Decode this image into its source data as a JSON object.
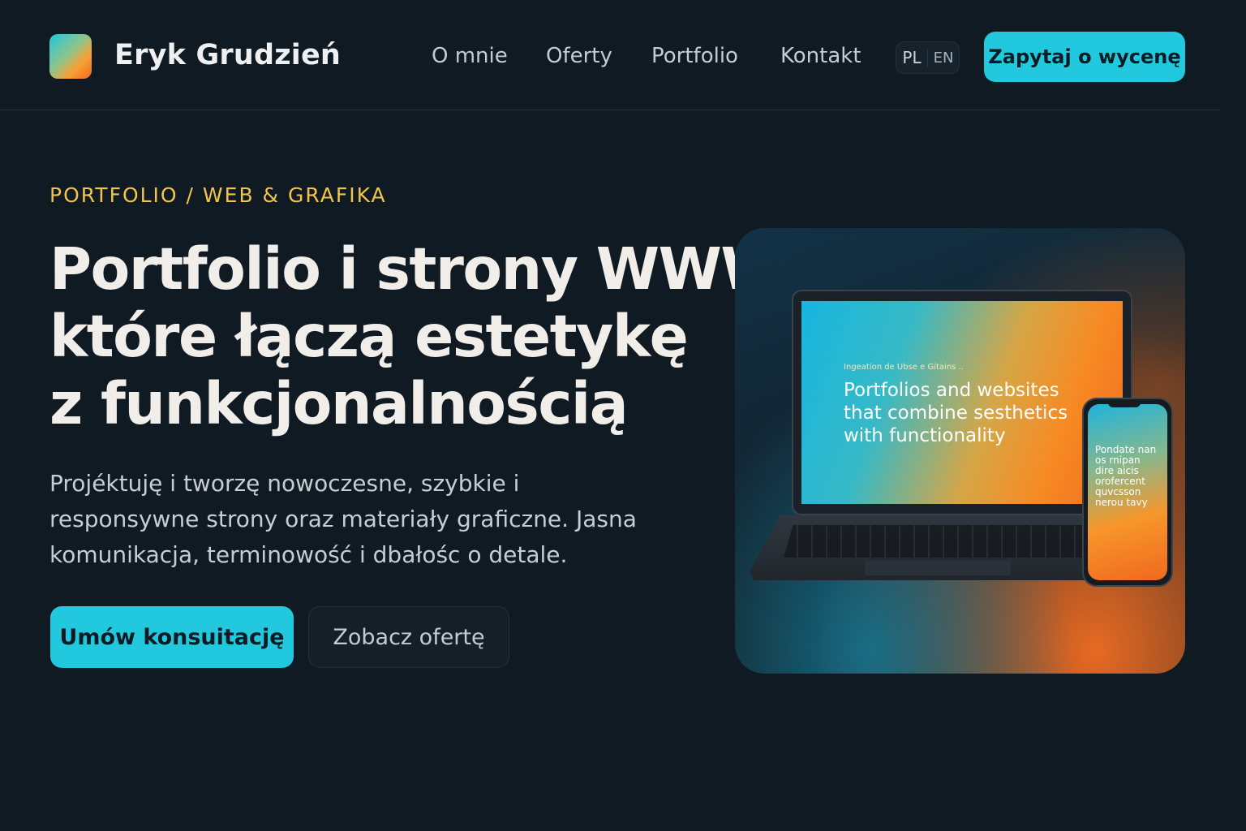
{
  "header": {
    "brand": "Eryk Grudzień",
    "nav": [
      "O mnie",
      "Oferty",
      "Portfolio",
      "Kontakt"
    ],
    "lang": [
      "PL",
      "EN"
    ],
    "cta_label": "Zapytaj o wycenę"
  },
  "hero": {
    "eyebrow": "PORTFOLIO / WEB & GRAFIKA",
    "headline": [
      "Portfolio i strony WWW,",
      "które łączą estetykę",
      "z funkcjonalnością"
    ],
    "lead": "Projéktuję i tworzę nowoczesne, szybkie i responsywne strony oraz materiały graficzne. Jasna komunikacja, terminowość i dbałośc o detale.",
    "primary_button": "Umów konsuitację",
    "secondary_button": "Zobacz ofertę"
  },
  "mockup": {
    "laptop_small": "Ingeation de Ubse e Gitains ..",
    "laptop_title": "Portfolios and websites that combine sesthetics with functionality",
    "phone_text": "Pondate nan\nos rnipan\ndire aicis\norofercent\nquvcsson\nnerou tavy"
  },
  "colors": {
    "background": "#0f1a22",
    "accent": "#21c8de",
    "eyebrow": "#f4c44a",
    "orange": "#f26a23"
  },
  "icons": {
    "logo": "gradient-square-logo"
  }
}
